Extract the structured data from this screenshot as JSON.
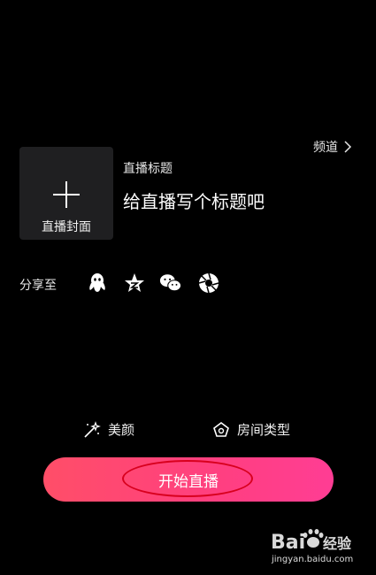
{
  "header": {
    "channel_label": "频道"
  },
  "cover": {
    "label": "直播封面"
  },
  "title": {
    "label": "直播标题",
    "placeholder": "给直播写个标题吧"
  },
  "share": {
    "label": "分享至",
    "targets": [
      "qq-icon",
      "qzone-icon",
      "wechat-icon",
      "moments-icon"
    ]
  },
  "options": {
    "beauty_label": "美颜",
    "room_type_label": "房间类型"
  },
  "start_button": {
    "label": "开始直播"
  },
  "watermark": {
    "brand": "Bai",
    "brand_suffix": "经验",
    "url": "jingyan.baidu.com"
  },
  "colors": {
    "accent_start": "#ff4e68",
    "accent_end": "#ff3d94",
    "annotation": "#d8001e"
  }
}
